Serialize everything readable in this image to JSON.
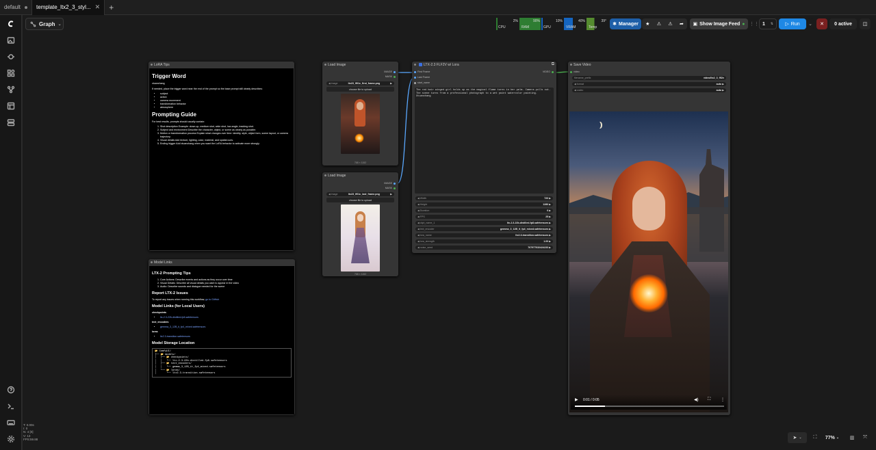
{
  "tabs": [
    {
      "label": "default"
    },
    {
      "label": "template_ltx2_3_styl..."
    }
  ],
  "graph_button": {
    "label": "Graph"
  },
  "meters": [
    {
      "label": "CPU",
      "value": "2%",
      "color": "#2e7d32"
    },
    {
      "label": "RAM",
      "value": "90%",
      "color": "#2e7d32"
    },
    {
      "label": "GPU",
      "value": "10%",
      "color": "#1565c0"
    },
    {
      "label": "VRAM",
      "value": "40%",
      "color": "#1565c0"
    },
    {
      "label": "Temp",
      "value": "39°",
      "color": "#558b2f"
    }
  ],
  "toolbar": {
    "manager_label": "Manager",
    "show_feed_label": "Show Image Feed",
    "queue_count": "1",
    "run_label": "Run",
    "active_label": "0 active"
  },
  "lora_tips": {
    "title": "LoRA Tips",
    "heading1": "Trigger Word",
    "trigger": "xtuanchang",
    "intro": "If needed, place the trigger word near the end of the prompt so the base prompt still clearly describes:",
    "bullets": [
      "subject",
      "action",
      "camera movement",
      "transformation behavior",
      "atmosphere"
    ],
    "heading2": "Prompting Guide",
    "guide_intro": "For best results, prompts should usually contain:",
    "steps": [
      "Shot description Example: close-up, medium shot, wide shot, low-angle, tracking shot.",
      "Subject and environment Describe the character, object, or scene as clearly as possible.",
      "Motion or transformation process Explain what changes over time: identity, style, object form, scene layout, or camera trajectory.",
      "Visual details Add texture, lighting, color, material, and spatial cues.",
      "Ending trigger Add xtuanchang when you want the LoRA behavior to activate more strongly."
    ]
  },
  "model_links": {
    "title": "Model Links",
    "h_tips": "LTX-2 Prompting Tips",
    "tips": [
      "Core Actions: Describe events and actions as they occur over time",
      "Visual Details: Describe all visual details you want to appear in the video",
      "Audio: Describe sounds and dialogue needed for the scene"
    ],
    "h_report": "Report LTX-2 Issues",
    "report_text": "To report any issues when running this workflow,",
    "report_link": "go to GitHub",
    "h_models": "Model Links (for Local Users)",
    "checkpoints_label": "checkpoints",
    "checkpoint_link": "ltx-2.3-22b-distilled-fp8.safetensors",
    "text_encoders_label": "text_encoders",
    "text_encoder_link": "gemma_3_12B_it_fp4_mixed.safetensors",
    "loras_label": "loras",
    "lora_link": "ltx2.3-transition.safetensors",
    "h_storage": "Model Storage Location",
    "tree": [
      "📂 ComfyUI/",
      "├── 📂 models/",
      "│   ├── 📂 checkpoints/",
      "│   │   └── ltx-2.3-22b-distilled-fp8.safetensors",
      "│   ├── 📂 text_encoders/",
      "│   │   └── gemma_3_12B_it_fp4_mixed.safetensors",
      "│   └── 📂 loras/",
      "│       └── ltx2.3-transition.safetensors"
    ]
  },
  "load_image_1": {
    "title": "Load Image",
    "out_image": "IMAGE",
    "out_mask": "MASK",
    "image_name_label": "image",
    "image_value": "ltx23_lf01c_first_frame.png",
    "upload_label": "choose file to upload",
    "caption": "768 × 1152"
  },
  "load_image_2": {
    "title": "Load Image",
    "out_image": "IMAGE",
    "out_mask": "MASK",
    "image_name_label": "image",
    "image_value": "ltx23_lf01c_last_frame.png",
    "upload_label": "choose file to upload",
    "caption": "768 × 1152"
  },
  "ltx_node": {
    "title": "LTX-2.3 FLF2V w/ Lora",
    "in_first": "First Frame",
    "in_last": "Last Frame",
    "in_text": "start_name",
    "out_video": "VIDEO",
    "prompt": "The red hair winged girl holds up as the magical flame turns in her palm. Camera pulls out. The scene turns from a professional photograph to a wet paint watercolor painting. Xtuanchang",
    "widgets": [
      {
        "name": "Width",
        "value": "720"
      },
      {
        "name": "Height",
        "value": "1280"
      },
      {
        "name": "Duration",
        "value": "6"
      },
      {
        "name": "FPS",
        "value": "25"
      },
      {
        "name": "ckpt_name_1",
        "value": "ltx-2.3-22b-distilled-fp8.safetensors"
      },
      {
        "name": "text_encoder",
        "value": "gemma_3_12B_it_fp4_mixed.safetensors"
      },
      {
        "name": "lora_name",
        "value": "ltx2.3-transition.safetensors"
      },
      {
        "name": "lora_strength",
        "value": "1.00"
      },
      {
        "name": "noise_seed",
        "value": "767977632424233"
      }
    ]
  },
  "save_video": {
    "title": "Save Video",
    "in_video": "video",
    "widgets": [
      {
        "name": "filename_prefix",
        "value": "video/ltx2_3_flf2v"
      },
      {
        "name": "format",
        "value": "auto"
      },
      {
        "name": "codec",
        "value": "auto"
      }
    ],
    "time": "0:01 / 0:05"
  },
  "stats": [
    "T: 0.00s",
    "I: 0",
    "N: 4 [0]",
    "V: 13",
    "FPS:59.88"
  ],
  "zoom": "77%",
  "colors": {
    "accent": "#1e88e5",
    "run": "#1e88e5",
    "link": "#4aa3ff"
  }
}
